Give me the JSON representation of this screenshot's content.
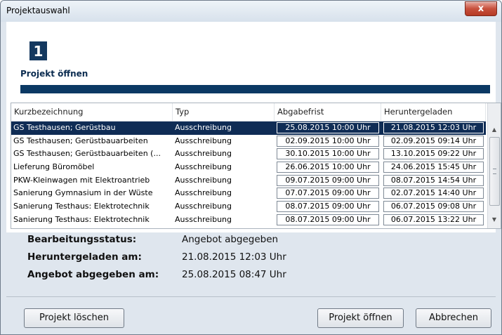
{
  "window": {
    "title": "Projektauswahl",
    "close_symbol": "x"
  },
  "step": {
    "number": "1",
    "title": "Projekt öffnen"
  },
  "table": {
    "columns": [
      "Kurzbezeichnung",
      "Typ",
      "Abgabefrist",
      "Heruntergeladen"
    ],
    "rows": [
      [
        "GS Testhausen; Gerüstbau",
        "Ausschreibung",
        "25.08.2015 10:00 Uhr",
        "21.08.2015 12:03 Uhr"
      ],
      [
        "GS Testhausen; Gerüstbauarbeiten",
        "Ausschreibung",
        "02.09.2015 10:00 Uhr",
        "02.09.2015 09:14 Uhr"
      ],
      [
        "GS Testhausen; Gerüstbauarbeiten (...",
        "Ausschreibung",
        "30.10.2015 10:00 Uhr",
        "13.10.2015 09:22 Uhr"
      ],
      [
        "Lieferung Büromöbel",
        "Ausschreibung",
        "26.06.2015 10:00 Uhr",
        "24.06.2015 15:45 Uhr"
      ],
      [
        "PKW-Kleinwagen mit Elektroantrieb",
        "Ausschreibung",
        "09.07.2015 09:00 Uhr",
        "08.07.2015 14:54 Uhr"
      ],
      [
        "Sanierung Gymnasium in der Wüste",
        "Ausschreibung",
        "07.07.2015 09:00 Uhr",
        "02.07.2015 14:40 Uhr"
      ],
      [
        "Sanierung Testhaus: Elektrotechnik",
        "Ausschreibung",
        "08.07.2015 09:00 Uhr",
        "06.07.2015 09:08 Uhr"
      ],
      [
        "Sanierung Testhaus: Elektrotechnik",
        "Ausschreibung",
        "08.07.2015 09:00 Uhr",
        "06.07.2015 13:22 Uhr"
      ]
    ],
    "selected_row": 0
  },
  "details": {
    "status_label": "Bearbeitungsstatus:",
    "status_value": "Angebot abgegeben",
    "downloaded_label": "Heruntergeladen am:",
    "downloaded_value": "21.08.2015 12:03 Uhr",
    "submitted_label": "Angebot abgegeben am:",
    "submitted_value": "25.08.2015 08:47 Uhr"
  },
  "buttons": {
    "delete": "Projekt löschen",
    "open": "Projekt öffnen",
    "cancel": "Abbrechen"
  },
  "colors": {
    "accent": "#0b3964",
    "selection": "#0f2c55"
  }
}
